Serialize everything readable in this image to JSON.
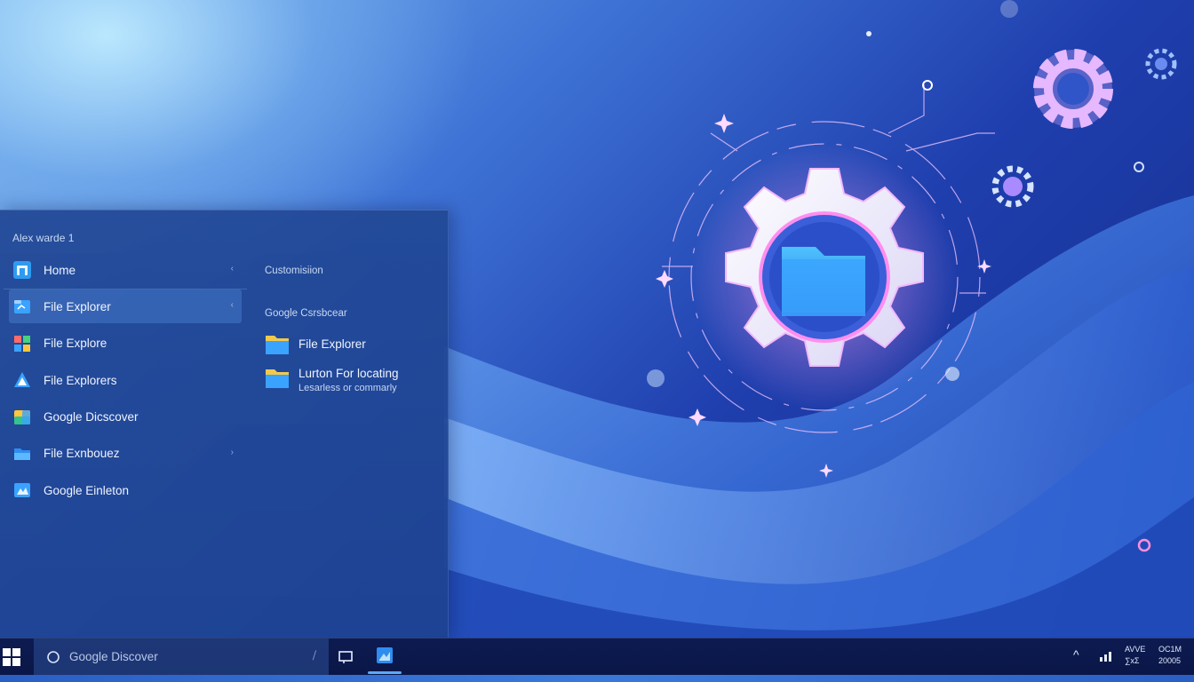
{
  "start_menu": {
    "user_name": "Alex warde 1",
    "apps": [
      {
        "label": "Home",
        "icon": "home-app-icon",
        "chevron": "‹",
        "selected": false
      },
      {
        "label": "File Explorer",
        "icon": "file-explorer-icon",
        "chevron": "‹",
        "selected": true
      },
      {
        "label": "File Explore",
        "icon": "grid-app-icon",
        "chevron": "",
        "selected": false
      },
      {
        "label": "File Explorers",
        "icon": "triangle-app-icon",
        "chevron": "",
        "selected": false
      },
      {
        "label": "Google Dicscover",
        "icon": "google-discover-icon",
        "chevron": "",
        "selected": false
      },
      {
        "label": "File Exnbouez",
        "icon": "folder-open-icon",
        "chevron": "›",
        "selected": false
      },
      {
        "label": "Google Einleton",
        "icon": "google-einleton-icon",
        "chevron": "",
        "selected": false
      }
    ],
    "customisation_label": "Customisiion",
    "section_label": "Google Csrsbcear",
    "pinned": [
      {
        "title": "File Explorer",
        "subtitle": "",
        "icon": "folder-icon"
      },
      {
        "title": "Lurton For locating",
        "subtitle": "Lesarless or commarly",
        "icon": "folder-icon"
      }
    ]
  },
  "taskbar": {
    "start_icon": "windows-logo-icon",
    "search_placeholder": "Google Discover",
    "search_icon": "search-icon",
    "search_right_glyph": "⧸",
    "task_view_icon": "task-view-icon",
    "pinned_app_icon": "app-icon",
    "tray_chevron": "^",
    "network_icon": "network-icon",
    "tray_label_1_top": "AVVE",
    "tray_label_1_bottom": "∑xΣ",
    "tray_label_2_top": "OC1M",
    "tray_label_2_bottom": "20005"
  },
  "colors": {
    "accent": "#5ca8ff",
    "menu_bg": "#21489a",
    "taskbar_bg": "#0d1b52"
  }
}
